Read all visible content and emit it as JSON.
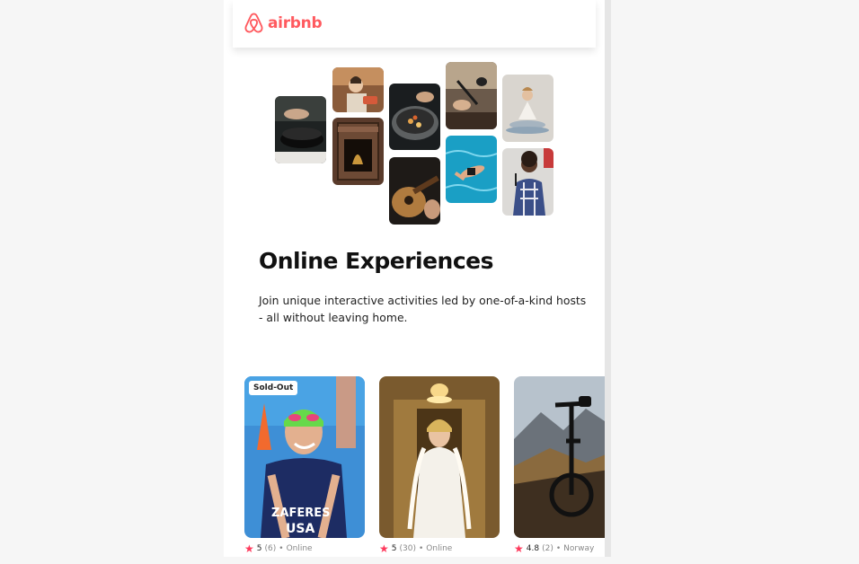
{
  "brand": {
    "name": "airbnb",
    "color": "#ff5a5f"
  },
  "hero": {
    "title": "Online Experiences",
    "subtitle": "Join unique interactive activities led by one-of-a-kind hosts - all without leaving home."
  },
  "photo_grid": [
    "cooking-pot",
    "woman-with-cake",
    "fireplace",
    "pan-with-dish",
    "guitar-player",
    "microphone",
    "swimmer-in-pool",
    "meditation",
    "singer"
  ],
  "cards": [
    {
      "badge": "Sold-Out",
      "rating": "5",
      "reviews": "(6)",
      "separator": "•",
      "location": "Online",
      "image": "triathlete-swimmer"
    },
    {
      "badge": "",
      "rating": "5",
      "reviews": "(30)",
      "separator": "•",
      "location": "Online",
      "image": "bride-in-hallway"
    },
    {
      "badge": "",
      "rating": "4.8",
      "reviews": "(2)",
      "separator": "•",
      "location": "Norway",
      "image": "bicycle-on-mountain"
    }
  ],
  "colors": {
    "star": "#fe395c",
    "text": "#222222"
  }
}
